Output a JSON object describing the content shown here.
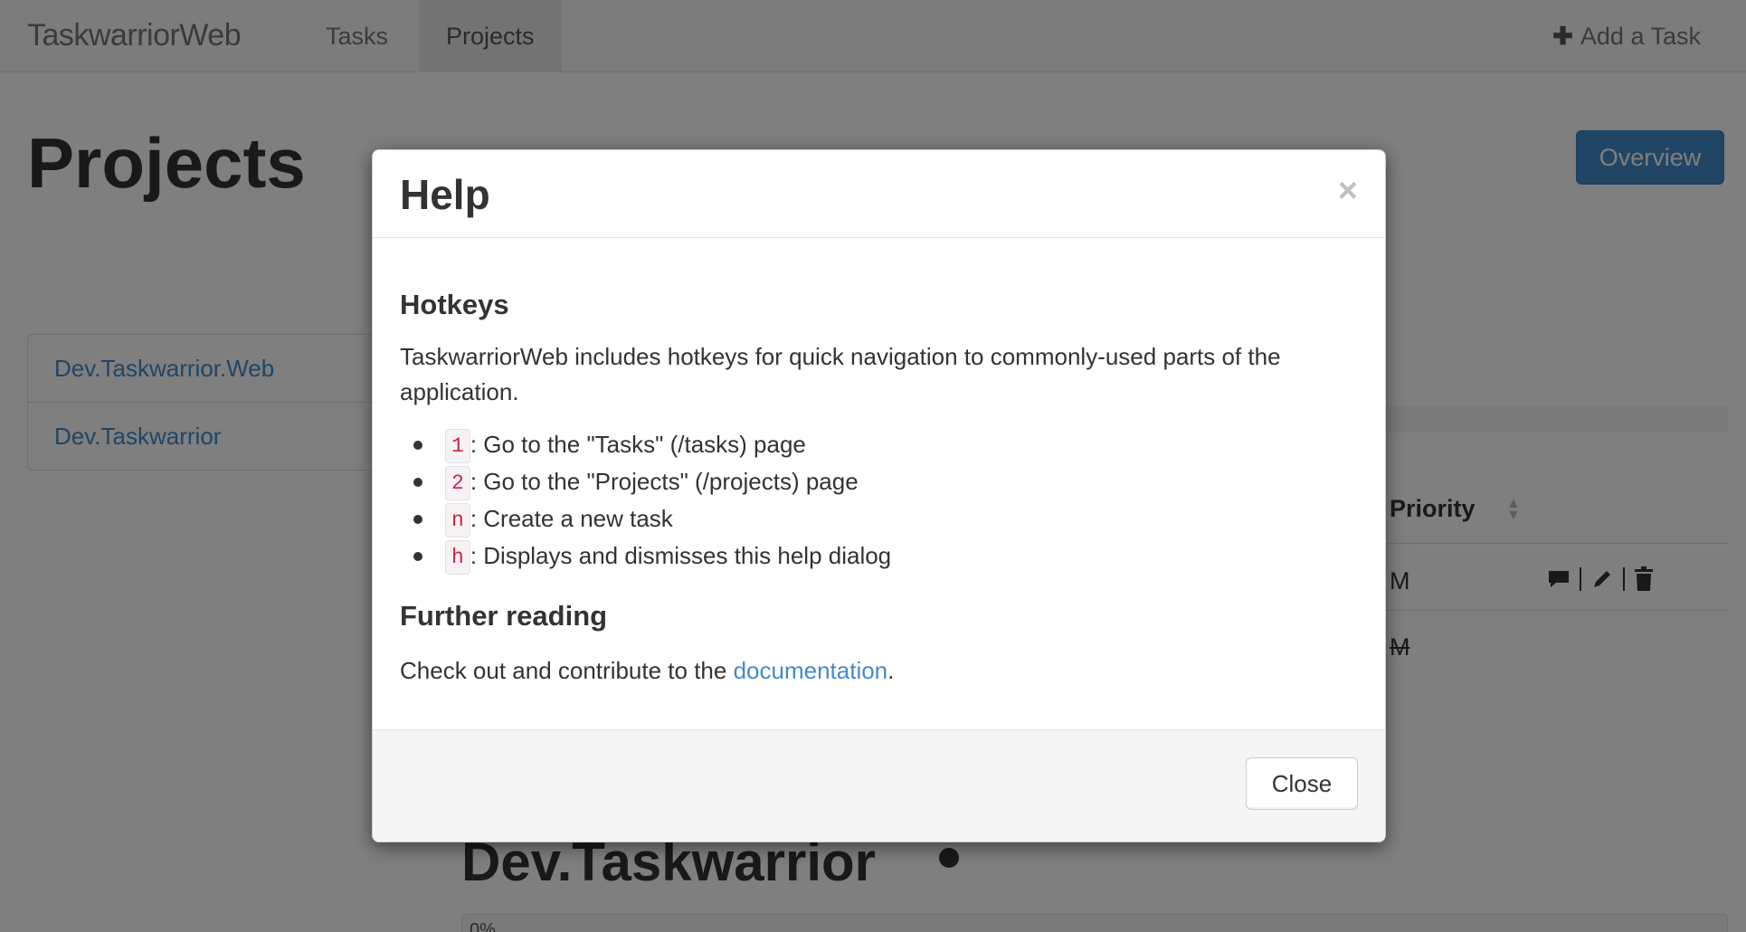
{
  "navbar": {
    "brand": "TaskwarriorWeb",
    "tabs": [
      {
        "label": "Tasks",
        "active": false
      },
      {
        "label": "Projects",
        "active": true
      }
    ],
    "add_task_icon": "plus-icon",
    "add_task_label": "Add a Task"
  },
  "page": {
    "title": "Projects",
    "overview_button": "Overview",
    "projects": [
      {
        "label": "Dev.Taskwarrior.Web"
      },
      {
        "label": "Dev.Taskwarrior"
      }
    ],
    "table": {
      "priority_header": "Priority",
      "rows": [
        {
          "priority": "M",
          "completed": false
        },
        {
          "priority": "M",
          "completed": true
        }
      ],
      "row_action_icons": [
        "comment-icon",
        "pencil-icon",
        "trash-icon"
      ]
    },
    "section_title": "Dev.Taskwarrior",
    "section_progress_label": "0%"
  },
  "modal": {
    "title": "Help",
    "close_glyph": "×",
    "hotkeys_heading": "Hotkeys",
    "intro": "TaskwarriorWeb includes hotkeys for quick navigation to commonly-used parts of the application.",
    "hotkeys": [
      {
        "key": "1",
        "description": ": Go to the \"Tasks\" (/tasks) page"
      },
      {
        "key": "2",
        "description": ": Go to the \"Projects\" (/projects) page"
      },
      {
        "key": "n",
        "description": ": Create a new task"
      },
      {
        "key": "h",
        "description": ": Displays and dismisses this help dialog"
      }
    ],
    "further_heading": "Further reading",
    "further_prefix": "Check out and contribute to the ",
    "further_link": "documentation",
    "further_suffix": ".",
    "close_button": "Close"
  },
  "colors": {
    "link": "#428bca",
    "primary_button": "#428bca",
    "code_text": "#c7254e",
    "backdrop": "rgba(0,0,0,0.5)"
  }
}
